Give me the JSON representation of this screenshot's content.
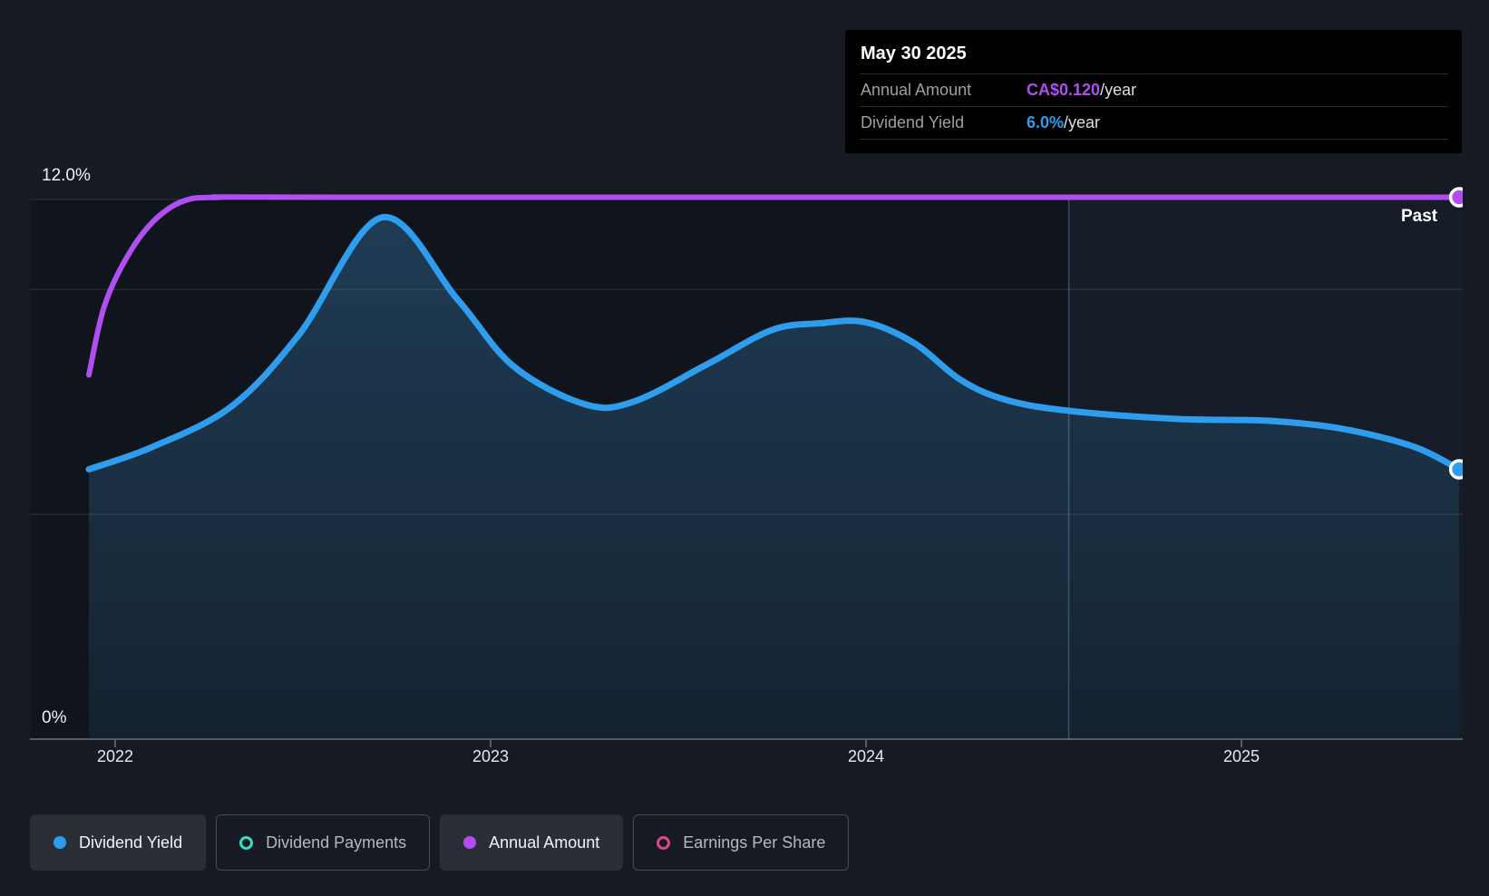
{
  "page": {
    "background": "#161b23",
    "plot_background": "#10151d"
  },
  "tooltip": {
    "date": "May 30 2025",
    "rows": [
      {
        "label": "Annual Amount",
        "value": "CA$0.120",
        "suffix": "/year",
        "value_color": "#b14ef2"
      },
      {
        "label": "Dividend Yield",
        "value": "6.0%",
        "suffix": "/year",
        "value_color": "#2f9ded"
      }
    ]
  },
  "past_label": "Past",
  "y_axis": {
    "top_label": "12.0%",
    "bottom_label": "0%"
  },
  "x_axis": {
    "labels": [
      "2022",
      "2023",
      "2024",
      "2025"
    ]
  },
  "legend": [
    {
      "label": "Dividend Yield",
      "marker": "filled",
      "color": "#2f9ded",
      "active": true
    },
    {
      "label": "Dividend Payments",
      "marker": "hollow",
      "color": "#3cdbc5",
      "active": false
    },
    {
      "label": "Annual Amount",
      "marker": "filled",
      "color": "#b14ef2",
      "active": true
    },
    {
      "label": "Earnings Per Share",
      "marker": "hollow",
      "color": "#d9478c",
      "active": false
    }
  ],
  "chart_data": {
    "type": "line",
    "ylim": [
      0,
      12
    ],
    "xlim": [
      2021.93,
      2025.58
    ],
    "y_unit": "%",
    "gridlines_pct": [
      12,
      10,
      5,
      0
    ],
    "x_ticks": [
      2022,
      2023,
      2024,
      2025
    ],
    "divider_x": 2024.54,
    "past_region_from_x": 2024.54,
    "legend_position": "bottom",
    "series": [
      {
        "name": "Dividend Yield",
        "color": "#2f9ded",
        "area": true,
        "end_marker": true,
        "end_value_pct": 6.0,
        "points": [
          [
            2021.93,
            6.0
          ],
          [
            2022.1,
            6.5
          ],
          [
            2022.31,
            7.4
          ],
          [
            2022.49,
            9.0
          ],
          [
            2022.71,
            11.6
          ],
          [
            2022.91,
            9.8
          ],
          [
            2023.06,
            8.3
          ],
          [
            2023.25,
            7.45
          ],
          [
            2023.38,
            7.5
          ],
          [
            2023.58,
            8.35
          ],
          [
            2023.75,
            9.1
          ],
          [
            2023.88,
            9.25
          ],
          [
            2024.0,
            9.27
          ],
          [
            2024.13,
            8.8
          ],
          [
            2024.25,
            8.0
          ],
          [
            2024.37,
            7.55
          ],
          [
            2024.54,
            7.3
          ],
          [
            2024.83,
            7.12
          ],
          [
            2025.07,
            7.08
          ],
          [
            2025.27,
            6.9
          ],
          [
            2025.46,
            6.5
          ],
          [
            2025.58,
            6.0
          ]
        ]
      },
      {
        "name": "Annual Amount",
        "color": "#b14ef2",
        "area": false,
        "end_marker": true,
        "end_value": "CA$0.120/year",
        "points": [
          [
            2021.93,
            8.1
          ],
          [
            2021.97,
            9.6
          ],
          [
            2022.03,
            10.7
          ],
          [
            2022.1,
            11.5
          ],
          [
            2022.18,
            11.96
          ],
          [
            2022.28,
            12.05
          ],
          [
            2022.6,
            12.05
          ],
          [
            2025.58,
            12.05
          ]
        ]
      }
    ]
  }
}
